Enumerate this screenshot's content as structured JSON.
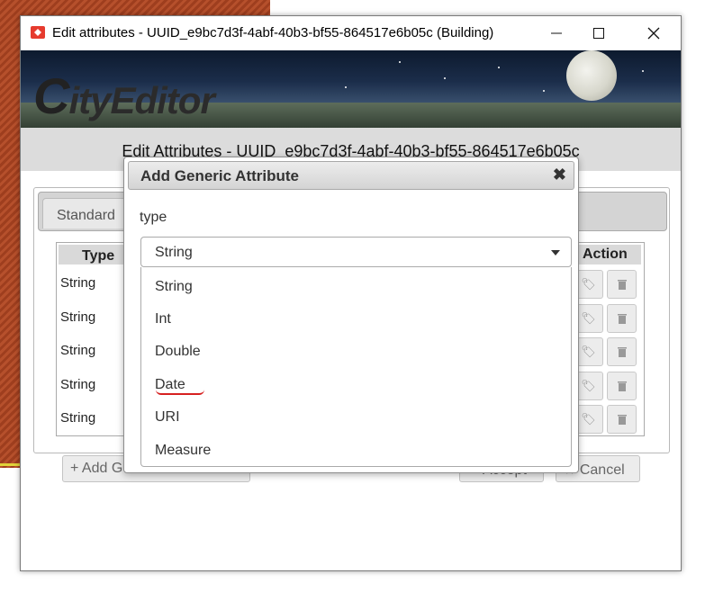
{
  "window": {
    "title": "Edit attributes - UUID_e9bc7d3f-4abf-40b3-bf55-864517e6b05c (Building)",
    "minimize_icon": "minimize-icon",
    "maximize_icon": "maximize-icon",
    "close_icon": "close-icon"
  },
  "banner": {
    "logo_c": "C",
    "logo_rest": "ityEditor"
  },
  "page": {
    "title": "Edit Attributes - UUID_e9bc7d3f-4abf-40b3-bf55-864517e6b05c"
  },
  "tabs": [
    {
      "label": "Standard"
    }
  ],
  "table": {
    "headers": {
      "type": "Type",
      "action": "Action"
    },
    "rows": [
      {
        "type": "String"
      },
      {
        "type": "String"
      },
      {
        "type": "String"
      },
      {
        "type": "String"
      },
      {
        "type": "String"
      }
    ]
  },
  "buttons": {
    "add_generic": "+ Add Generic Attribute",
    "accept": "✔ Accept",
    "cancel": "✖ Cancel"
  },
  "dialog": {
    "title": "Add Generic Attribute",
    "close": "✖",
    "type_label": "type",
    "selected": "String",
    "options": [
      "String",
      "Int",
      "Double",
      "Date",
      "URI",
      "Measure"
    ]
  },
  "colors": {
    "accent_red": "#d62020"
  }
}
